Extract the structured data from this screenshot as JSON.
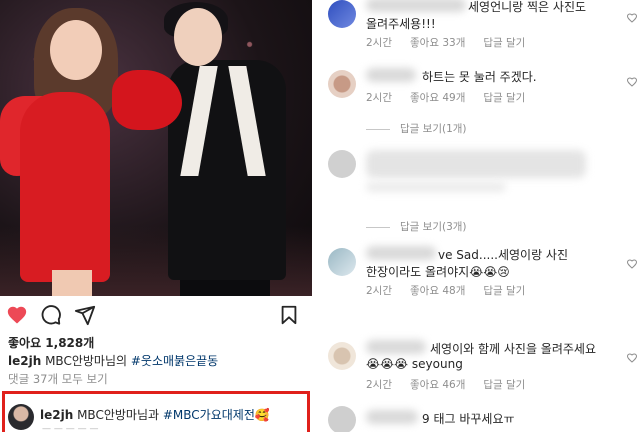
{
  "post": {
    "likes": "좋아요 1,828개",
    "caption": {
      "username": "le2jh",
      "text": " MBC안방마님의 ",
      "hashtag": "#웃소매붉은끝동"
    },
    "view_comments": "댓글 37개 모두 보기",
    "highlighted_comment": {
      "username": "le2jh",
      "text": " MBC안방마님과 ",
      "hashtag": "#MBC가요대제전",
      "emoji": "🥰"
    }
  },
  "comments": [
    {
      "text_line1": "세영언니랑 찍은 사진도",
      "text_line2": "올려주세용!!!",
      "time": "2시간",
      "likes": "좋아요 33개",
      "reply": "답글 달기"
    },
    {
      "text_line1": "하트는 못 눌러 주겠다.",
      "time": "2시간",
      "likes": "좋아요 49개",
      "reply": "답글 달기",
      "view_replies": "답글 보기(1개)"
    },
    {
      "view_replies": "답글 보기(3개)"
    },
    {
      "text_line1": "ve Sad.....세영이랑 사진",
      "text_line2": "한장이라도 올려야지",
      "emoji": "😭😭😢",
      "time": "2시간",
      "likes": "좋아요 48개",
      "reply": "답글 달기"
    },
    {
      "text_line1": "세영이와 함께 사진을 올려주세요",
      "text_line2": "seyoung",
      "emoji": "😭😭😭",
      "time": "2시간",
      "likes": "좋아요 46개",
      "reply": "답글 달기"
    },
    {
      "text_line1": "9 태그 바꾸세요ㅠ"
    }
  ],
  "icons": {
    "like": "heart-filled-icon",
    "comment": "comment-bubble-icon",
    "share": "paper-plane-icon",
    "save": "bookmark-icon",
    "comment_like": "heart-outline-icon"
  },
  "colors": {
    "like_red": "#ed4956",
    "highlight_border": "#e0201b",
    "hashtag": "#00376b",
    "meta_gray": "#8e8e8e"
  }
}
